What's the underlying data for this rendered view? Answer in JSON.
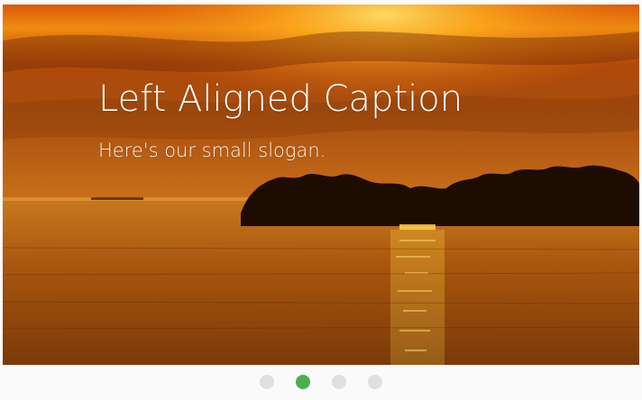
{
  "slider": {
    "caption": {
      "title": "Left Aligned Caption",
      "slogan": "Here's our small slogan."
    },
    "indicators": {
      "count": 4,
      "active_index": 1,
      "active_color": "#4caf50",
      "inactive_color": "#e0e0e0"
    },
    "image": {
      "subject": "sunset-over-water"
    }
  }
}
